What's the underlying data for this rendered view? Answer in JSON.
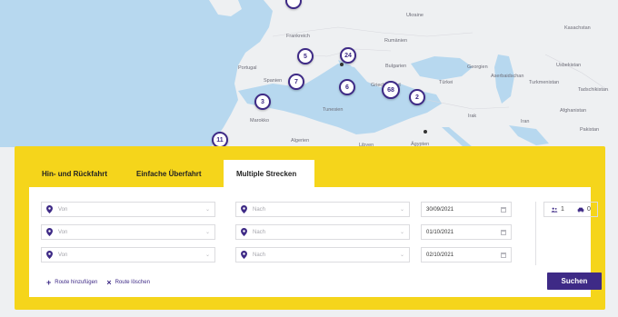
{
  "map": {
    "labels": {
      "ukraine": "Ukraine",
      "frankreich": "Frankreich",
      "rumaenien": "Rumänien",
      "kasachstan": "Kasachstan",
      "usbekistan": "Usbekistan",
      "portugal": "Portugal",
      "spanien": "Spanien",
      "bulgarien": "Bulgarien",
      "georgien": "Georgien",
      "aserbaidschan": "Aserbaidschan",
      "turkmenistan": "Turkmenistan",
      "tadschikistan": "Tadschikistan",
      "tuerkei": "Türkei",
      "griechenland": "Griechenland",
      "irak": "Irak",
      "iran": "Iran",
      "afghanistan": "Afghanistan",
      "marokko": "Marokko",
      "tunesien": "Tunesien",
      "pakistan": "Pakistan",
      "algerien": "Algerien",
      "libyen": "Libyen",
      "aegypten": "Ägypten"
    },
    "pins": {
      "p_top": "",
      "p24": "24",
      "p5": "5",
      "p7": "7",
      "p6": "6",
      "p68": "68",
      "p2": "2",
      "p3": "3",
      "p11": "11"
    }
  },
  "tabs": {
    "roundtrip": "Hin- und Rückfahrt",
    "oneway": "Einfache Überfahrt",
    "multi": "Multiple Strecken"
  },
  "routes": [
    {
      "from_placeholder": "Von",
      "to_placeholder": "Nach",
      "date": "30/09/2021"
    },
    {
      "from_placeholder": "Von",
      "to_placeholder": "Nach",
      "date": "01/10/2021"
    },
    {
      "from_placeholder": "Von",
      "to_placeholder": "Nach",
      "date": "02/10/2021"
    }
  ],
  "passengers": {
    "persons": "1",
    "vehicles": "0"
  },
  "actions": {
    "add_route": "Route hinzufügen",
    "delete_route": "Route löschen",
    "search": "Suchen"
  },
  "colors": {
    "accent": "#3e2a86",
    "panel": "#f5d51b",
    "sea": "#b7d8ef",
    "land": "#eef0f2"
  }
}
